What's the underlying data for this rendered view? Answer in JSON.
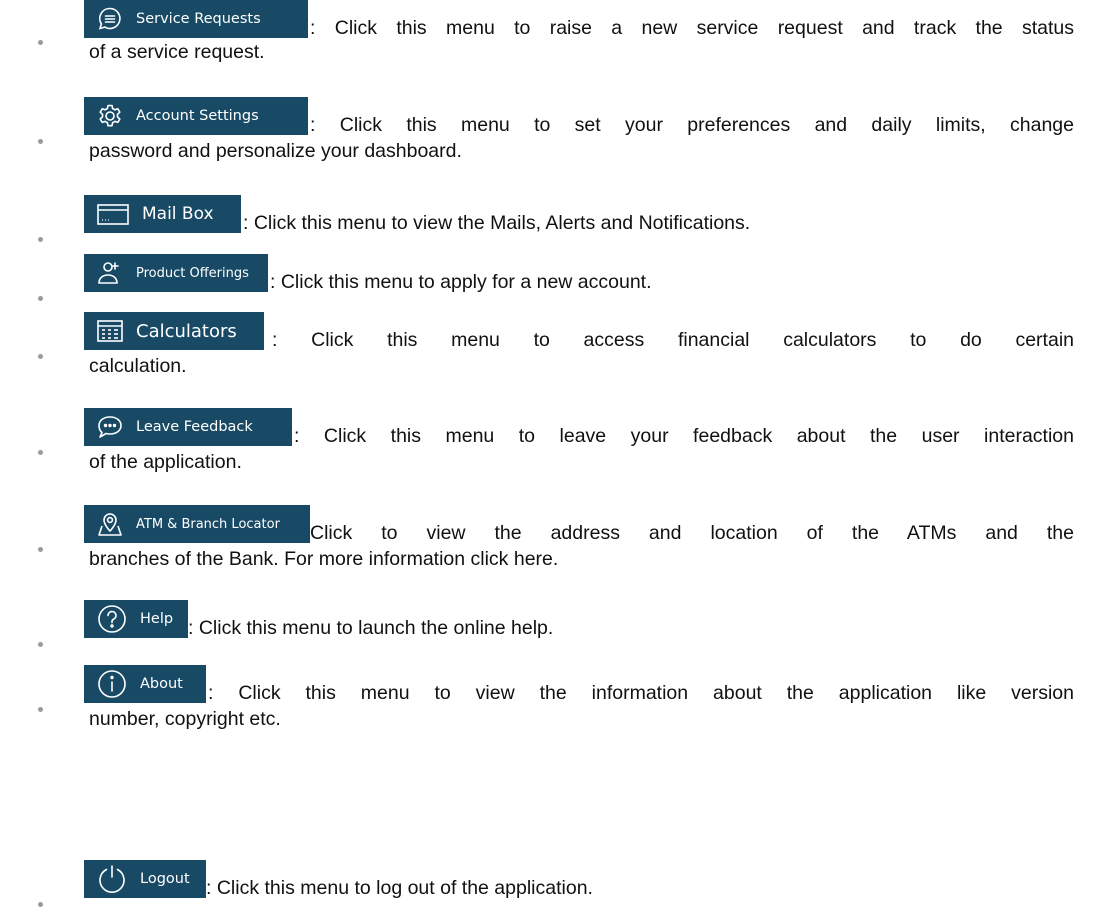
{
  "items": [
    {
      "label": "Service Requests",
      "icon": "chat-bubble-lines-icon",
      "text1": ": Click this menu to raise a new service request and track the status",
      "text2": "of a service request."
    },
    {
      "label": "Account Settings",
      "icon": "gear-icon",
      "text1": ": Click this menu to set your preferences and daily limits, change",
      "text2": "password and personalize your dashboard."
    },
    {
      "label": "Mail Box",
      "icon": "mailbox-icon",
      "text1": ": Click this menu to view the Mails, Alerts and Notifications.",
      "text2": ""
    },
    {
      "label": "Product Offerings",
      "icon": "add-user-icon",
      "text1": ": Click this menu to apply for a new account.",
      "text2": ""
    },
    {
      "label": "Calculators",
      "icon": "calculator-icon",
      "text1": ": Click this menu to access financial calculators to do certain",
      "text2": "calculation."
    },
    {
      "label": "Leave Feedback",
      "icon": "feedback-bubble-icon",
      "text1": ": Click this menu to leave your feedback about the user interaction",
      "text2": "of the application."
    },
    {
      "label": "ATM & Branch Locator",
      "icon": "map-pin-icon",
      "text1": "Click to view the address and location of the ATMs and the",
      "text2": "branches of the Bank. For more information click here."
    },
    {
      "label": "Help",
      "icon": "question-circle-icon",
      "text1": ": Click this menu to launch the online help.",
      "text2": ""
    },
    {
      "label": "About",
      "icon": "info-circle-icon",
      "text1": ": Click this menu to view the information about the application like version",
      "text2": "number, copyright etc."
    },
    {
      "label": "Logout",
      "icon": "power-icon",
      "text1": ": Click this menu to log out of the application.",
      "text2": ""
    }
  ],
  "colors": {
    "chip_background": "#184a66",
    "chip_text": "#ffffff",
    "body_text": "#111111",
    "bullet": "#9a9a9a"
  }
}
